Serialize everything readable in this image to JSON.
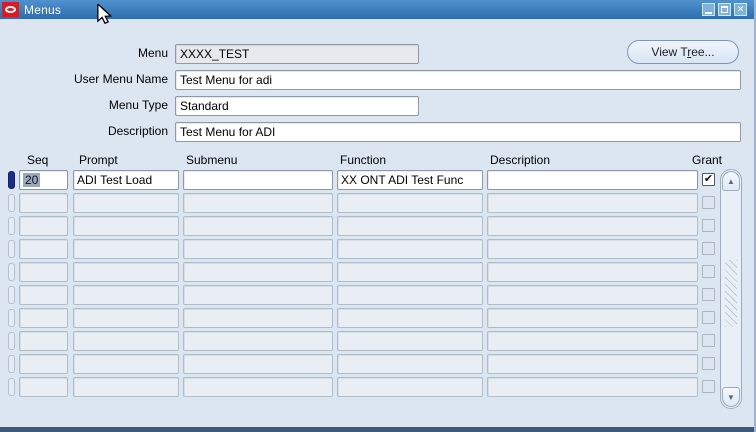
{
  "window": {
    "title": "Menus"
  },
  "icons": {
    "close": "✕",
    "checkmark": "✔",
    "scroll_up": "▲",
    "scroll_down": "▼",
    "oracle_logo": "red-badge-white-ring",
    "minimize": "underscore-bar",
    "maximize": "restore-square",
    "cursor": "arrow-pointer"
  },
  "form": {
    "fields": [
      {
        "label": "Menu",
        "value": "XXXX_TEST"
      },
      {
        "label": "User Menu Name",
        "value": "Test Menu for adi"
      },
      {
        "label": "Menu Type",
        "value": "Standard"
      },
      {
        "label": "Description",
        "value": "Test Menu for ADI"
      }
    ],
    "view_tree_button": {
      "pre": "View T",
      "underlined": "r",
      "post": "ee..."
    }
  },
  "table": {
    "headers": [
      "Seq",
      "Prompt",
      "Submenu",
      "Function",
      "Description",
      "Grant"
    ],
    "rows": [
      {
        "seq": "20",
        "prompt": "ADI Test Load",
        "submenu": "",
        "function": "XX ONT ADI Test Func",
        "description": "",
        "grant": true,
        "selected": true,
        "active": true
      },
      {
        "seq": "",
        "prompt": "",
        "submenu": "",
        "function": "",
        "description": "",
        "grant": false,
        "selected": false,
        "active": false
      },
      {
        "seq": "",
        "prompt": "",
        "submenu": "",
        "function": "",
        "description": "",
        "grant": false,
        "selected": false,
        "active": false
      },
      {
        "seq": "",
        "prompt": "",
        "submenu": "",
        "function": "",
        "description": "",
        "grant": false,
        "selected": false,
        "active": false
      },
      {
        "seq": "",
        "prompt": "",
        "submenu": "",
        "function": "",
        "description": "",
        "grant": false,
        "selected": false,
        "active": false
      },
      {
        "seq": "",
        "prompt": "",
        "submenu": "",
        "function": "",
        "description": "",
        "grant": false,
        "selected": false,
        "active": false
      },
      {
        "seq": "",
        "prompt": "",
        "submenu": "",
        "function": "",
        "description": "",
        "grant": false,
        "selected": false,
        "active": false
      },
      {
        "seq": "",
        "prompt": "",
        "submenu": "",
        "function": "",
        "description": "",
        "grant": false,
        "selected": false,
        "active": false
      },
      {
        "seq": "",
        "prompt": "",
        "submenu": "",
        "function": "",
        "description": "",
        "grant": false,
        "selected": false,
        "active": false
      },
      {
        "seq": "",
        "prompt": "",
        "submenu": "",
        "function": "",
        "description": "",
        "grant": false,
        "selected": false,
        "active": false
      }
    ]
  },
  "colors": {
    "titlebar": "#2e75bb",
    "content_bg": "#dce6f1",
    "logo_red": "#dd1b21",
    "record_indicator": "#1b2c8a",
    "selection_highlight": "#9ca8ba",
    "bottom_strip": "#3d5a7c"
  }
}
